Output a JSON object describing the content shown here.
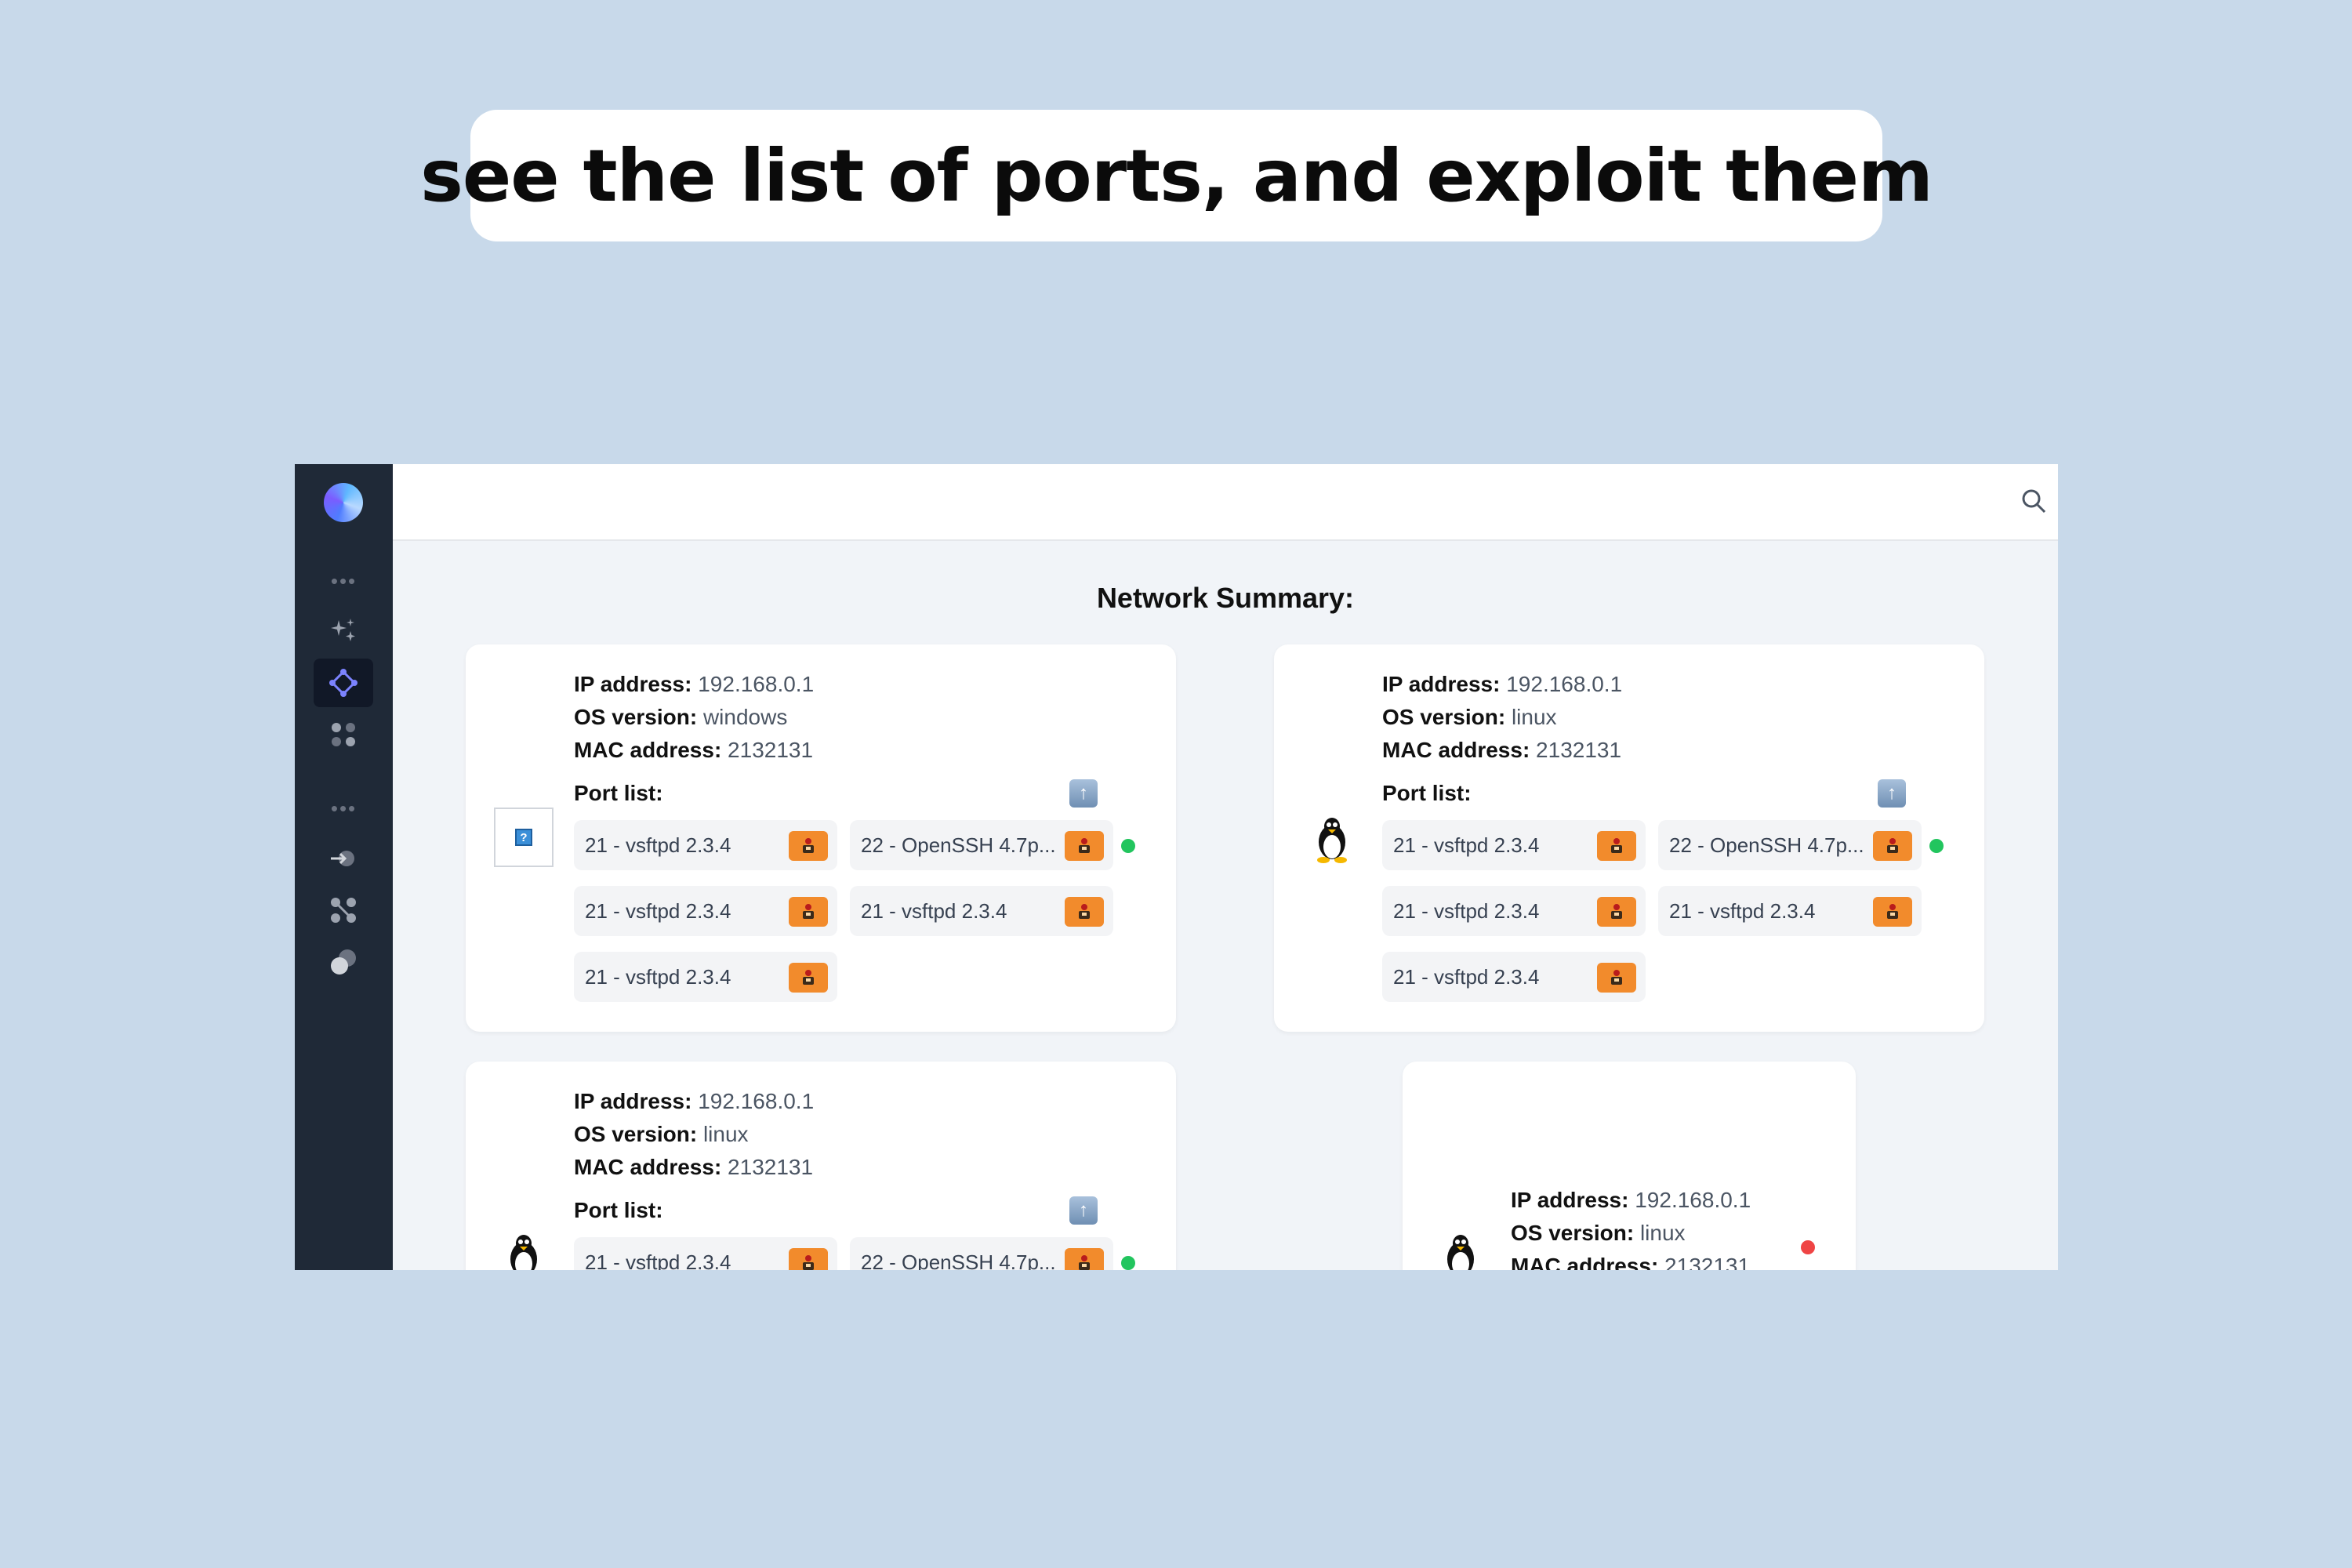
{
  "banner": {
    "text": "see the list of ports, and exploit them"
  },
  "icons": {
    "logo": "app-logo",
    "sidebar": [
      "more-dots",
      "sparkles",
      "network-nodes",
      "apps-grid",
      "more-dots",
      "login-arrow",
      "share-graph",
      "toggle-circles"
    ],
    "topbar": [
      "search",
      "sun-theme-toggle"
    ]
  },
  "main": {
    "title": "Network Summary:"
  },
  "hosts": [
    {
      "ip_label": "IP address:",
      "ip": "192.168.0.1",
      "os_label": "OS version:",
      "os": "windows",
      "mac_label": "MAC address:",
      "mac": "2132131",
      "ports_label": "Port list:",
      "ports": [
        "21 - vsftpd 2.3.4",
        "22 - OpenSSH 4.7p...",
        "21 - vsftpd 2.3.4",
        "21 - vsftpd 2.3.4",
        "21 - vsftpd 2.3.4"
      ],
      "status_color": "#22c55e"
    },
    {
      "ip_label": "IP address:",
      "ip": "192.168.0.1",
      "os_label": "OS version:",
      "os": "linux",
      "mac_label": "MAC address:",
      "mac": "2132131",
      "ports_label": "Port list:",
      "ports": [
        "21 - vsftpd 2.3.4",
        "22 - OpenSSH 4.7p...",
        "21 - vsftpd 2.3.4",
        "21 - vsftpd 2.3.4",
        "21 - vsftpd 2.3.4"
      ],
      "status_color": "#22c55e"
    },
    {
      "ip_label": "IP address:",
      "ip": "192.168.0.1",
      "os_label": "OS version:",
      "os": "linux",
      "mac_label": "MAC address:",
      "mac": "2132131",
      "ports_label": "Port list:",
      "ports": [
        "21 - vsftpd 2.3.4",
        "22 - OpenSSH 4.7p..."
      ],
      "status_color": "#22c55e"
    },
    {
      "ip_label": "IP address:",
      "ip": "192.168.0.1",
      "os_label": "OS version:",
      "os": "linux",
      "mac_label": "MAC address:",
      "mac": "2132131",
      "status_color": "#ef4444"
    }
  ]
}
